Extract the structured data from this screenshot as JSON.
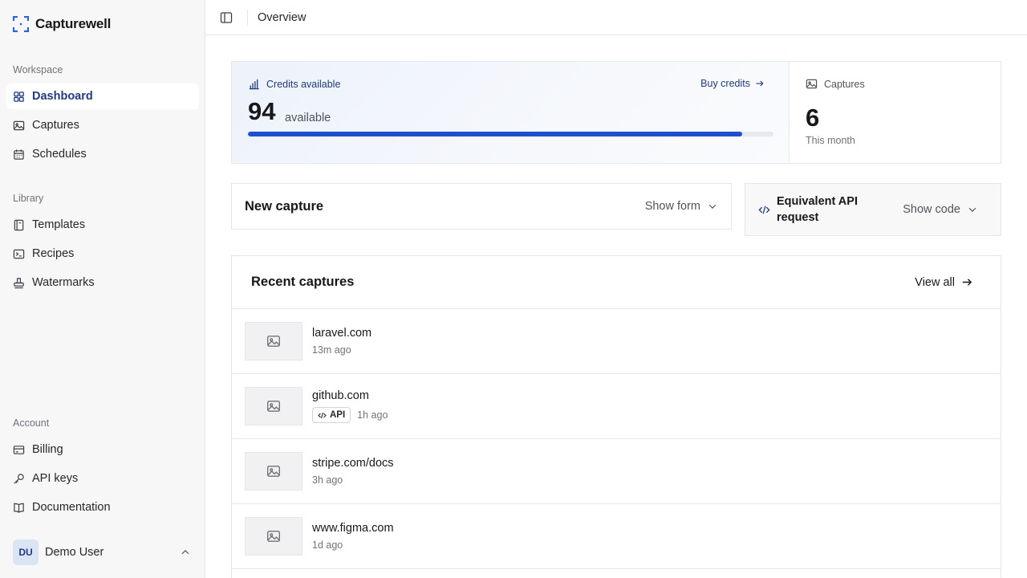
{
  "app": {
    "name": "Capturewell"
  },
  "sidebar": {
    "groups": [
      {
        "label": "Workspace",
        "items": [
          {
            "label": "Dashboard",
            "icon": "grid-icon",
            "active": true
          },
          {
            "label": "Captures",
            "icon": "image-icon"
          },
          {
            "label": "Schedules",
            "icon": "calendar-icon"
          }
        ]
      },
      {
        "label": "Library",
        "items": [
          {
            "label": "Templates",
            "icon": "book-icon"
          },
          {
            "label": "Recipes",
            "icon": "terminal-icon"
          },
          {
            "label": "Watermarks",
            "icon": "stamp-icon"
          }
        ]
      },
      {
        "label": "Account",
        "items": [
          {
            "label": "Billing",
            "icon": "card-icon"
          },
          {
            "label": "API keys",
            "icon": "key-icon"
          },
          {
            "label": "Documentation",
            "icon": "open-book-icon"
          }
        ]
      }
    ],
    "user": {
      "initials": "DU",
      "name": "Demo User"
    }
  },
  "topbar": {
    "title": "Overview"
  },
  "credits": {
    "label": "Credits available",
    "buy_label": "Buy credits",
    "value": "94",
    "suffix": "available",
    "fill_fraction": 0.94,
    "accent": "#1d4ed8"
  },
  "captures_stat": {
    "label": "Captures",
    "value": "6",
    "sub": "This month"
  },
  "new_capture": {
    "title": "New capture",
    "toggle_label": "Show form"
  },
  "api_request": {
    "title": "Equivalent API request",
    "toggle_label": "Show code"
  },
  "recent": {
    "title": "Recent captures",
    "view_all_label": "View all",
    "items": [
      {
        "title": "laravel.com",
        "time": "13m ago",
        "badge": ""
      },
      {
        "title": "github.com",
        "time": "1h ago",
        "badge": "API"
      },
      {
        "title": "stripe.com/docs",
        "time": "3h ago",
        "badge": ""
      },
      {
        "title": "www.figma.com",
        "time": "1d ago",
        "badge": ""
      }
    ]
  }
}
